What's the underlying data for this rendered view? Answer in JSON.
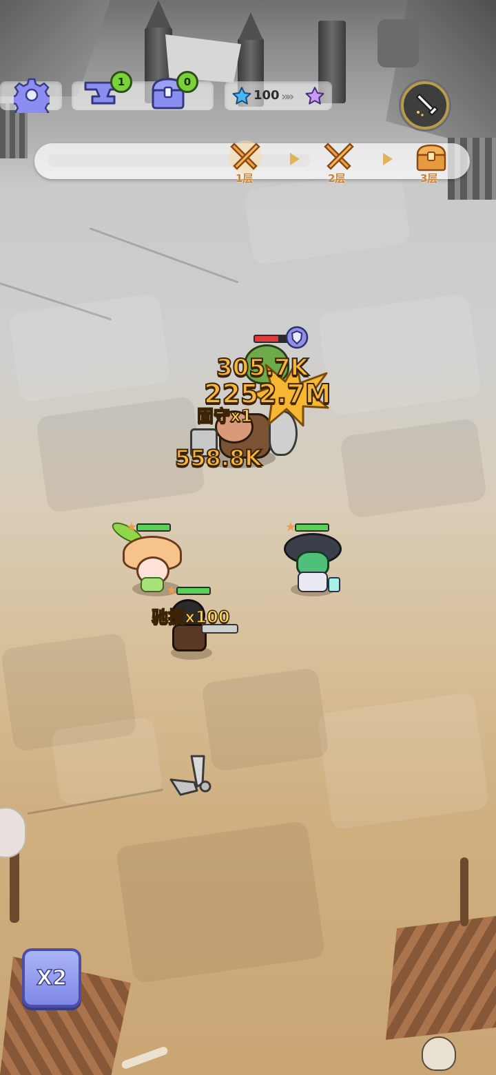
{
  "hud": {
    "settings_icon": "gear-icon",
    "anvil_count": "1",
    "chest_count": "0",
    "stars_value": "100",
    "floors": [
      {
        "label": "1层",
        "icon": "crossed-swords-icon",
        "state": "current"
      },
      {
        "label": "2层",
        "icon": "crossed-swords-icon",
        "state": "upcoming"
      },
      {
        "label": "3层",
        "icon": "treasure-chest-icon",
        "state": "upcoming"
      }
    ]
  },
  "battle": {
    "damage_numbers": [
      "305.7K",
      "2252.7M",
      "558.8K"
    ],
    "buff_labels": [
      "固守x1",
      "驰援x100"
    ],
    "enemy_hp_fraction": 0.7
  },
  "heroes": [
    {
      "name": "mushroom-girl",
      "star_count": 1,
      "hp_fraction": 1.0
    },
    {
      "name": "snake-hat-doctor",
      "star_count": 1,
      "hp_fraction": 1.0
    },
    {
      "name": "crossbow-hero",
      "star_count": 1,
      "hp_fraction": 1.0
    }
  ],
  "controls": {
    "speed_label": "X2"
  },
  "colors": {
    "hp_green": "#57d154",
    "hp_red": "#e03a3a",
    "damage_gold": "#f6b53d",
    "speed_button": "#8c95ec"
  }
}
